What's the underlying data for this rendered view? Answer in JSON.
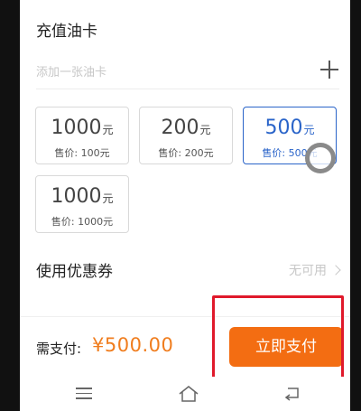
{
  "recharge": {
    "title": "充值油卡",
    "add_placeholder": "添加一张油卡",
    "options": [
      {
        "amount": "1000",
        "unit": "元",
        "price_label": "售价: 100元",
        "selected": false
      },
      {
        "amount": "200",
        "unit": "元",
        "price_label": "售价: 200元",
        "selected": false
      },
      {
        "amount": "500",
        "unit": "元",
        "price_label": "售价: 500元",
        "selected": true
      },
      {
        "amount": "1000",
        "unit": "元",
        "price_label": "售价: 1000元",
        "selected": false
      }
    ]
  },
  "coupon": {
    "label": "使用优惠券",
    "value": "无可用"
  },
  "payment": {
    "label": "需支付:",
    "amount": "¥500.00",
    "button_label": "立即支付"
  },
  "colors": {
    "accent_blue": "#2a64c9",
    "price_orange": "#f07d1e",
    "button_orange": "#f36d12",
    "highlight_red": "#e0192b"
  },
  "icons": {
    "add": "plus-icon",
    "coupon_arrow": "chevron-right-icon",
    "nav_menu": "menu-icon",
    "nav_home": "home-icon",
    "nav_back": "back-icon"
  }
}
